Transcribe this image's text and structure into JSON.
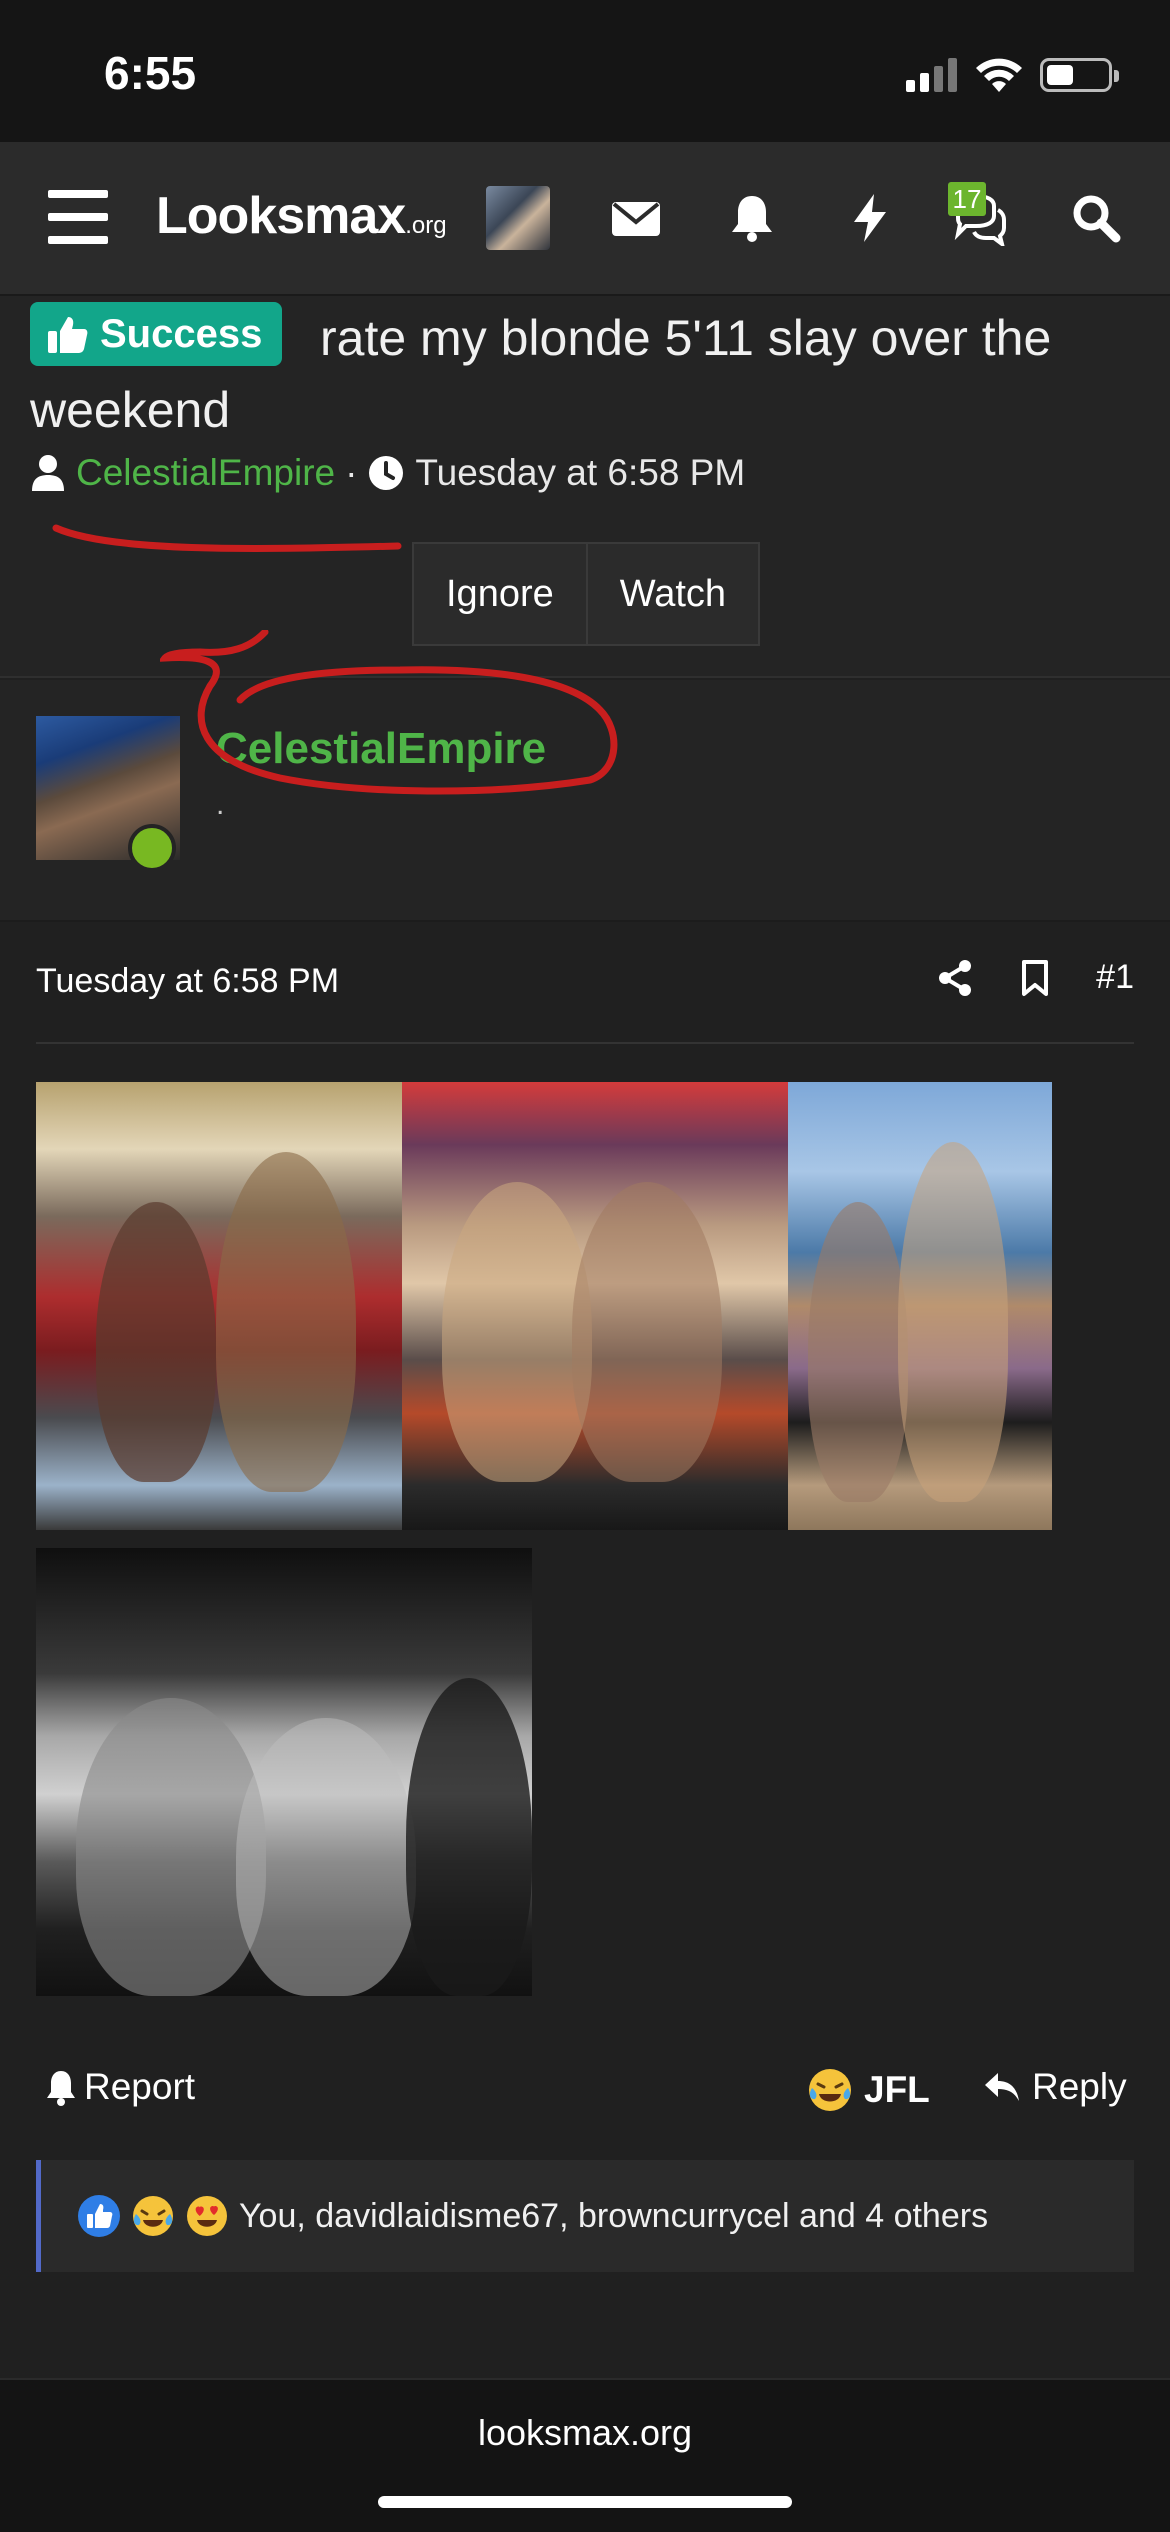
{
  "status_bar": {
    "time": "6:55"
  },
  "navbar": {
    "logo_main": "Looksmax",
    "logo_suffix": ".org",
    "conversation_badge": "17",
    "icons": [
      "menu-icon",
      "mail-icon",
      "bell-icon",
      "lightning-icon",
      "conversations-icon",
      "search-icon"
    ]
  },
  "thread": {
    "prefix_label": "Success",
    "title": "rate my blonde 5'11 slay over the weekend",
    "author": "CelestialEmpire",
    "separator": "·",
    "date": "Tuesday at 6:58 PM",
    "ignore_label": "Ignore",
    "watch_label": "Watch"
  },
  "post": {
    "username": "CelestialEmpire",
    "user_title": ".",
    "date": "Tuesday at 6:58 PM",
    "post_number": "#1",
    "report_label": "Report",
    "jfl_label": "JFL",
    "reply_label": "Reply",
    "reactions_text": "You, davidlaidisme67, browncurrycel and 4 others"
  },
  "footer": {
    "site": "looksmax.org"
  },
  "colors": {
    "accent_green": "#4fb548",
    "prefix_teal": "#12a68a",
    "badge_green": "#6cb52e",
    "online_green": "#78b822",
    "annotation_red": "#c81e1e",
    "reaction_border": "#5269c8"
  }
}
